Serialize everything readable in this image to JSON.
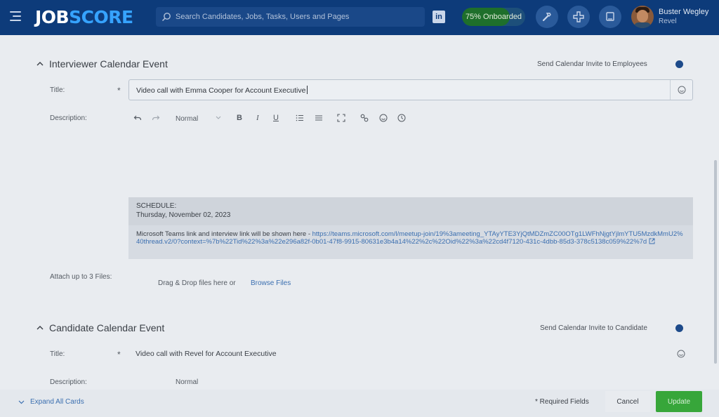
{
  "header": {
    "logo_part1": "JOB",
    "logo_part2": "SCORE",
    "search_placeholder": "Search Candidates, Jobs, Tasks, Users and Pages",
    "linkedin": "in",
    "onboarded_label": "75% Onboarded",
    "onboarded_percent": 75,
    "user_name": "Buster Wegley",
    "user_company": "Revel"
  },
  "interviewer_event": {
    "section_title": "Interviewer Calendar Event",
    "send_invite_label": "Send Calendar Invite to Employees",
    "title_label": "Title:",
    "required_mark": "*",
    "title_value": "Video call with Emma Cooper for Account Executive",
    "description_label": "Description:",
    "format_select": "Normal",
    "schedule_heading": "SCHEDULE:",
    "schedule_date": "Thursday, November 02, 2023",
    "schedule_note": "Microsoft Teams link and interview link will be shown here - ",
    "schedule_link": "https://teams.microsoft.com/l/meetup-join/19%3ameeting_YTAyYTE3YjQtMDZmZC00OTg1LWFhNjgtYjlmYTU5MzdkMmU2%40thread.v2/0?context=%7b%22Tid%22%3a%22e296a82f-0b01-47f8-9915-80631e3b4a14%22%2c%22Oid%22%3a%22cd4f7120-431c-4dbb-85d3-378c5138c059%22%7d",
    "attach_label": "Attach up to 3 Files:",
    "drop_text": "Drag & Drop files here or",
    "browse_label": "Browse Files"
  },
  "candidate_event": {
    "section_title": "Candidate Calendar Event",
    "send_invite_label": "Send Calendar Invite to Candidate",
    "title_label": "Title:",
    "required_mark": "*",
    "title_value": "Video call with Revel for Account Executive",
    "description_label": "Description:",
    "format_select": "Normal"
  },
  "footer": {
    "expand_label": "Expand All Cards",
    "required_fields": "* Required Fields",
    "cancel_label": "Cancel",
    "update_label": "Update"
  },
  "colors": {
    "header_bg": "#0d3b7a",
    "logo_accent": "#36a3ff",
    "link": "#3b6fb0",
    "update_green": "#37a63a",
    "toggle_dot": "#1d4a8a"
  }
}
